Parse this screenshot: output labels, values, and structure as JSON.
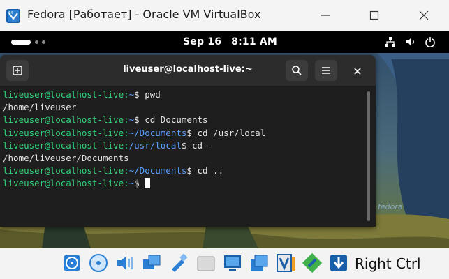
{
  "host_window": {
    "title": "Fedora [Работает] - Oracle VM VirtualBox",
    "controls": {
      "minimize": "—",
      "maximize": "☐",
      "close": "✕"
    }
  },
  "gnome_topbar": {
    "date": "Sep 16",
    "time": "8:11 AM",
    "tray_icons": [
      "network-icon",
      "volume-icon",
      "power-icon"
    ]
  },
  "terminal": {
    "title": "liveuser@localhost-live:~",
    "close_glyph": "✕",
    "lines": [
      {
        "kind": "prompt",
        "user": "liveuser@localhost-live",
        "sep": ":",
        "path": "~",
        "sym": "$ ",
        "cmd": "pwd"
      },
      {
        "kind": "output",
        "text": "/home/liveuser"
      },
      {
        "kind": "prompt",
        "user": "liveuser@localhost-live",
        "sep": ":",
        "path": "~",
        "sym": "$ ",
        "cmd": "cd Documents"
      },
      {
        "kind": "prompt",
        "user": "liveuser@localhost-live",
        "sep": ":",
        "path": "~/Documents",
        "sym": "$ ",
        "cmd": "cd /usr/local"
      },
      {
        "kind": "prompt",
        "user": "liveuser@localhost-live",
        "sep": ":",
        "path": "/usr/local",
        "sym": "$ ",
        "cmd": "cd -"
      },
      {
        "kind": "output",
        "text": "/home/liveuser/Documents"
      },
      {
        "kind": "prompt",
        "user": "liveuser@localhost-live",
        "sep": ":",
        "path": "~/Documents",
        "sym": "$ ",
        "cmd": "cd .."
      },
      {
        "kind": "prompt",
        "user": "liveuser@localhost-live",
        "sep": ":",
        "path": "~",
        "sym": "$ ",
        "cmd": ""
      }
    ]
  },
  "wallpaper": {
    "watermark": "fedora"
  },
  "statusbar": {
    "icons": [
      "hard-disk-icon",
      "optical-disk-icon",
      "audio-icon",
      "network-adapters-icon",
      "usb-icon",
      "shared-folders-icon",
      "display-icon",
      "recording-icon",
      "virtualization-icon",
      "mouse-integration-icon",
      "keyboard-capture-icon"
    ],
    "host_key": "Right Ctrl"
  },
  "colors": {
    "prompt_user": "#33d17a",
    "prompt_path": "#5aa0ff",
    "terminal_bg": "#1e1e1e",
    "header_bg": "#2c2c2c"
  }
}
